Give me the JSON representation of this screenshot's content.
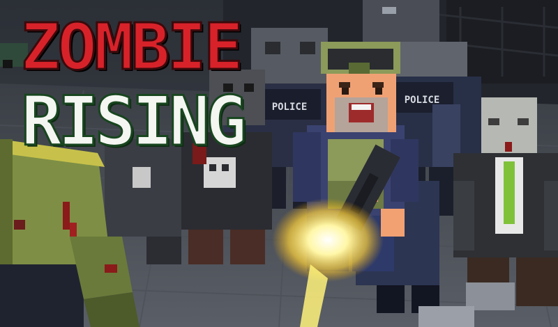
{
  "game": {
    "title_line1": "ZOMBIE",
    "title_line2": "RISING",
    "police_label": "POLICE"
  },
  "colors": {
    "title_red": "#d8222a",
    "title_white": "#f4f6f2",
    "title_outline_green": "#18461f",
    "zombie_green": "#6b8a3a",
    "muzzle_flash": "#fff27a",
    "police_uniform": "#2b3352"
  }
}
